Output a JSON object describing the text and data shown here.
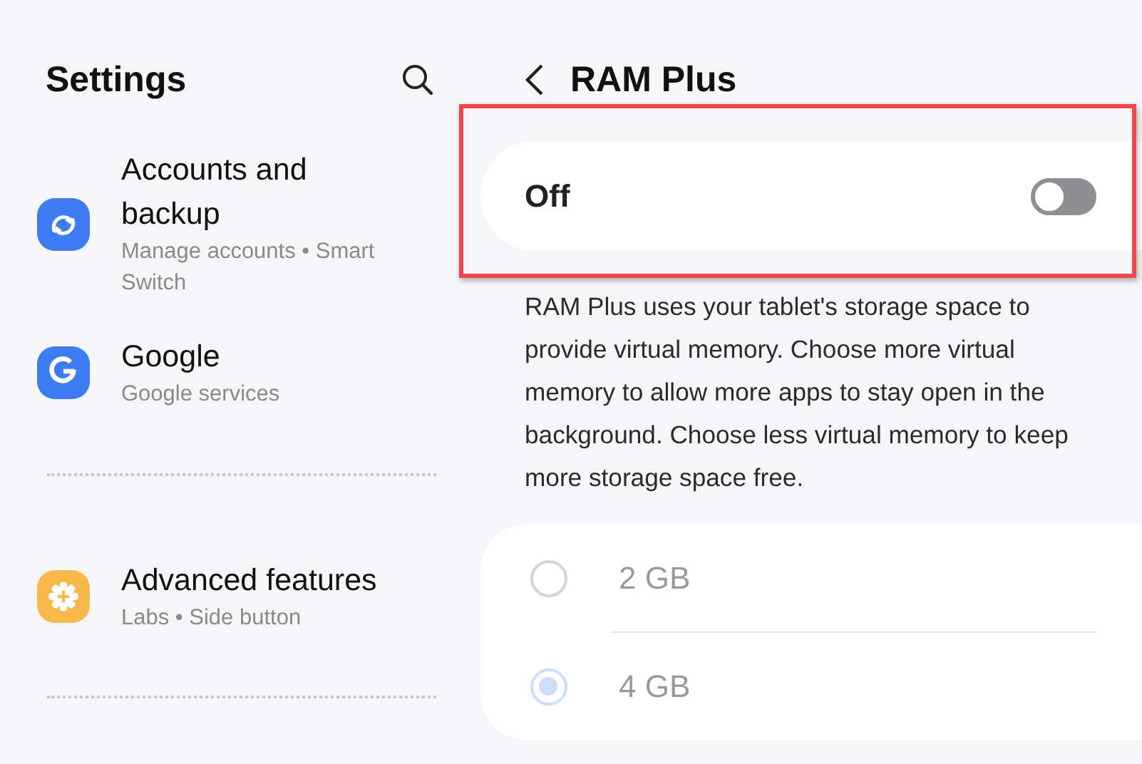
{
  "sidebar": {
    "title": "Settings",
    "items": [
      {
        "kind": "sync",
        "title": "Accounts and backup",
        "subtitle": "Manage accounts • Smart Switch"
      },
      {
        "kind": "google",
        "title": "Google",
        "subtitle": "Google services"
      },
      {
        "kind": "advanced",
        "title": "Advanced features",
        "subtitle": "Labs • Side button"
      }
    ]
  },
  "detail": {
    "title": "RAM Plus",
    "switch": {
      "label": "Off",
      "on": false
    },
    "annotation": {
      "kind": "frame"
    },
    "description": "RAM Plus uses your tablet's storage space to provide virtual memory. Choose more virtual memory to allow more apps to stay open in the background. Choose less virtual memory to keep more storage space free.",
    "options": [
      {
        "label": "2 GB",
        "selected": false,
        "disabled": true
      },
      {
        "label": "4 GB",
        "selected": true,
        "disabled": true
      }
    ]
  }
}
